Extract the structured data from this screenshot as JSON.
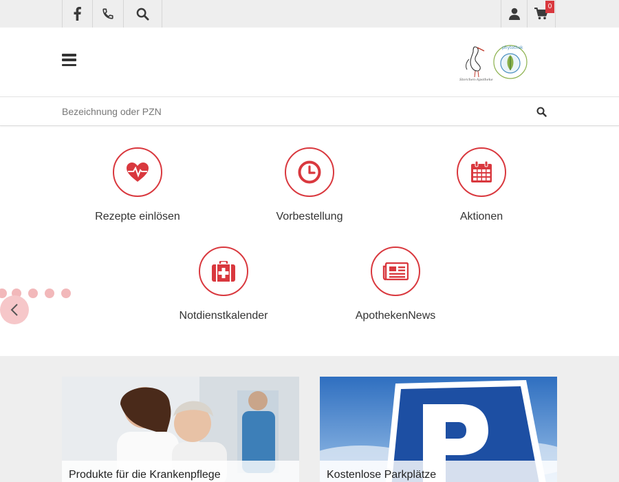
{
  "topbar": {
    "left_buttons": [
      {
        "icon": "facebook-icon"
      },
      {
        "icon": "phone-icon"
      },
      {
        "icon": "search-icon"
      }
    ],
    "right_buttons": [
      {
        "icon": "user-icon"
      },
      {
        "icon": "cart-icon"
      }
    ],
    "cart_count": "0"
  },
  "header": {
    "menu_icon": "hamburger-menu-icon",
    "logo_caption": "Storchen-Apotheke",
    "logo_badge": "phytothek"
  },
  "search": {
    "placeholder": "Bezeichnung oder PZN",
    "value": ""
  },
  "services": [
    {
      "label": "Rezepte einlösen",
      "icon": "heartbeat-icon"
    },
    {
      "label": "Vorbestellung",
      "icon": "clock-icon"
    },
    {
      "label": "Aktionen",
      "icon": "calendar-icon"
    },
    {
      "label": "Notdienstkalender",
      "icon": "medkit-icon"
    },
    {
      "label": "ApothekenNews",
      "icon": "newspaper-icon"
    }
  ],
  "slider": {
    "dot_count": 5,
    "prev_icon": "chevron-left-icon"
  },
  "cards": [
    {
      "caption": "Produkte für die Krankenpflege"
    },
    {
      "caption": "Kostenlose Parkplätze"
    }
  ],
  "colors": {
    "accent": "#d9383e",
    "topbar_bg": "#eeeeee",
    "section_bg": "#eeeeee",
    "dot": "#f2b8ba"
  }
}
